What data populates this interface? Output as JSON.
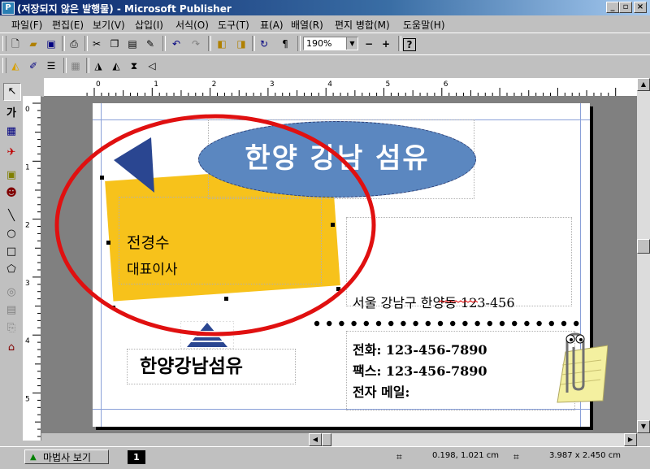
{
  "window": {
    "title": "(저장되지 않은 발행물) - Microsoft Publisher",
    "app_icon": "publisher-icon",
    "controls": [
      "_",
      "□",
      "×"
    ]
  },
  "menu": [
    "파일(F)",
    "편집(E)",
    "보기(V)",
    "삽입(I)",
    "서식(O)",
    "도구(T)",
    "표(A)",
    "배열(R)",
    "편지 병합(M)",
    "도움말(H)"
  ],
  "toolbar": {
    "zoom": "190%",
    "zoom_minus": "−",
    "zoom_plus": "+"
  },
  "ruler": {
    "h_labels": [
      "0",
      "1",
      "2",
      "3",
      "4",
      "5",
      "6"
    ],
    "v_labels": [
      "0",
      "1",
      "2",
      "3",
      "4",
      "5"
    ]
  },
  "card": {
    "company_oval": "한양 강남 섬유",
    "name": "전경수",
    "title": "대표이사",
    "address": "서울 강남구 한양동 123-456",
    "phone": "전화: 123-456-7890",
    "fax": "팩스: 123-456-7890",
    "email": "전자 메일:",
    "logo_text": "한양강남섬유"
  },
  "colors": {
    "oval": "#5b87c0",
    "yellow_box": "#f7c21b",
    "triangle": "#2a4691",
    "annotation_circle": "#e01010"
  },
  "status": {
    "wizard_button": "마법사 보기",
    "page_number": "1",
    "position": "0.198, 1.021 cm",
    "size": "3.987 x   2.450 cm"
  }
}
